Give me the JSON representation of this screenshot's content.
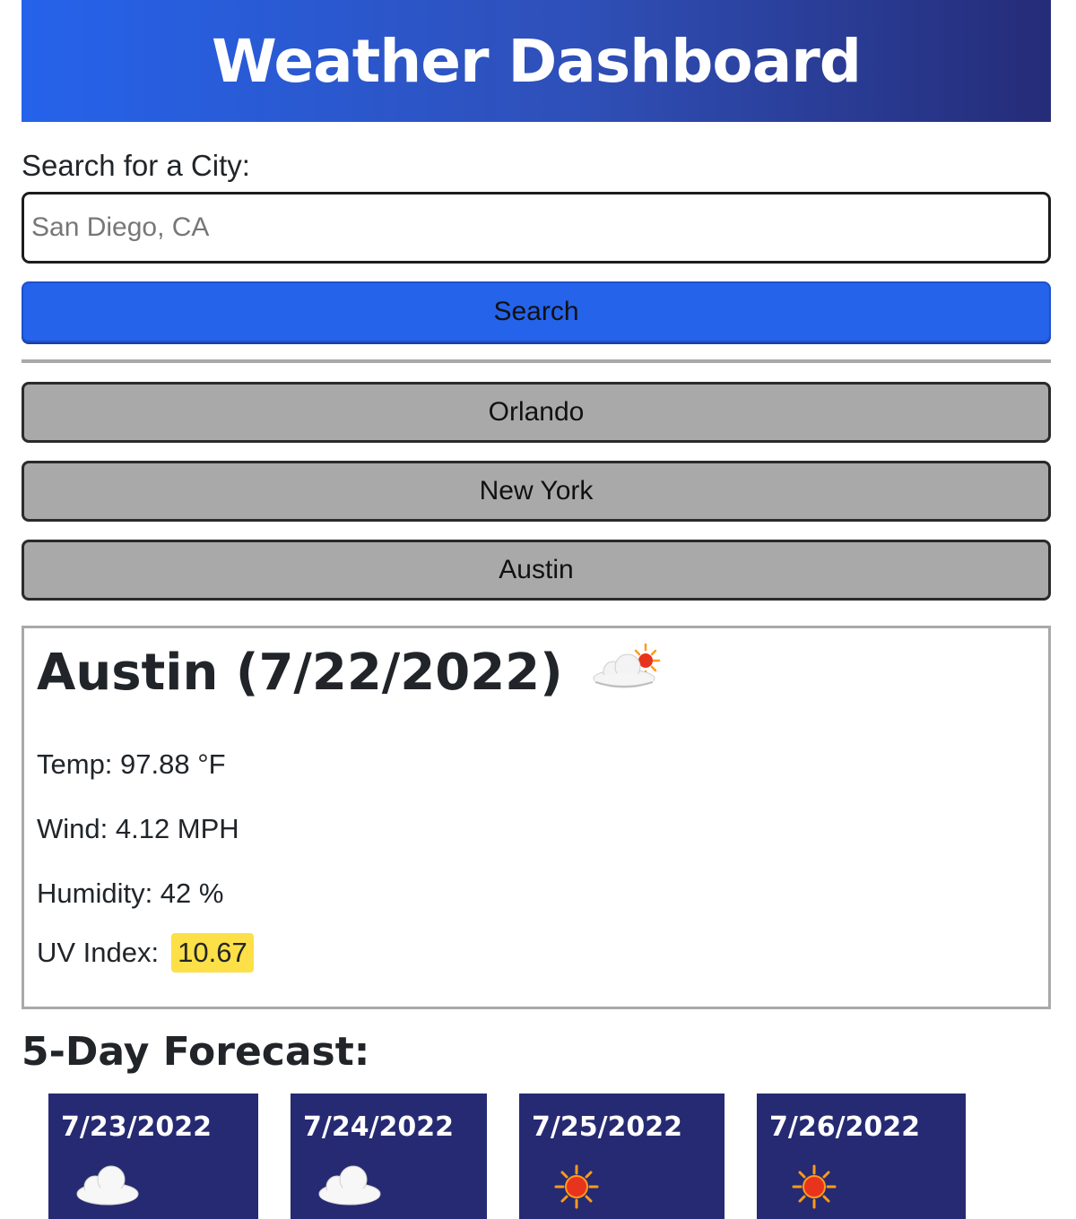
{
  "header": {
    "title": "Weather Dashboard"
  },
  "search": {
    "label": "Search for a City:",
    "placeholder": "San Diego, CA",
    "value": "",
    "button_label": "Search"
  },
  "history": [
    {
      "label": "Orlando"
    },
    {
      "label": "New York"
    },
    {
      "label": "Austin"
    }
  ],
  "current": {
    "title": "Austin (7/22/2022)",
    "icon": "partly-cloudy-icon",
    "temp": "Temp: 97.88 °F",
    "wind": "Wind: 4.12 MPH",
    "humidity": "Humidity: 42 %",
    "uv_label": "UV Index:",
    "uv_value": "10.67",
    "uv_color": "#fde047"
  },
  "forecast": {
    "heading": "5-Day Forecast:",
    "days": [
      {
        "date": "7/23/2022",
        "icon": "cloud-icon"
      },
      {
        "date": "7/24/2022",
        "icon": "cloud-icon"
      },
      {
        "date": "7/25/2022",
        "icon": "sun-icon"
      },
      {
        "date": "7/26/2022",
        "icon": "sun-icon"
      }
    ]
  },
  "colors": {
    "header_start": "#2563eb",
    "header_end": "#252c78",
    "search_button": "#2563eb",
    "history_button": "#a9a9a9",
    "forecast_card": "#262a72"
  }
}
